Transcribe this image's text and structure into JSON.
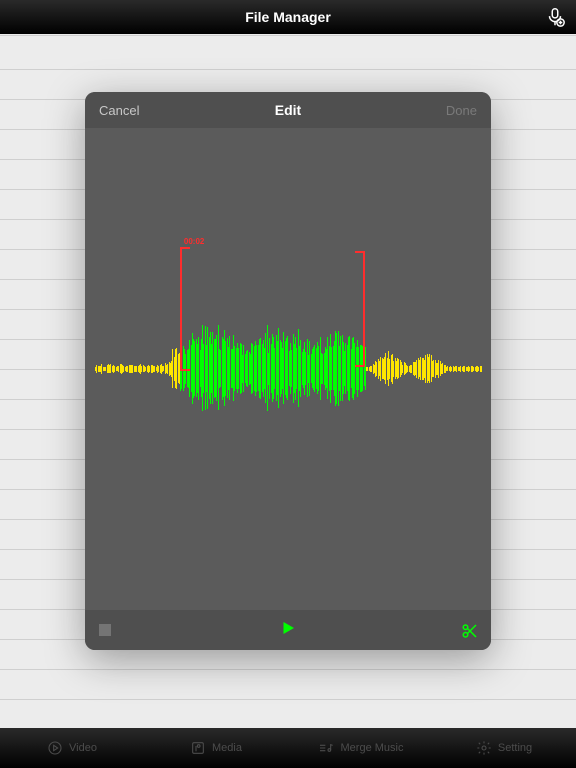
{
  "app_title": "File Manager",
  "editor": {
    "cancel_label": "Cancel",
    "title": "Edit",
    "done_label": "Done",
    "selection_start_label": "00:02",
    "selection_end_label": ""
  },
  "bottom_tabs": {
    "video": "Video",
    "media": "Media",
    "merge": "Merge Music",
    "settings": "Setting"
  },
  "colors": {
    "wave_outside": "#ffe600",
    "wave_inside": "#00ff00",
    "bracket": "#ff2d2d",
    "play": "#00ff00"
  },
  "waveform": {
    "selection_start": 0.22,
    "selection_end": 0.7
  }
}
